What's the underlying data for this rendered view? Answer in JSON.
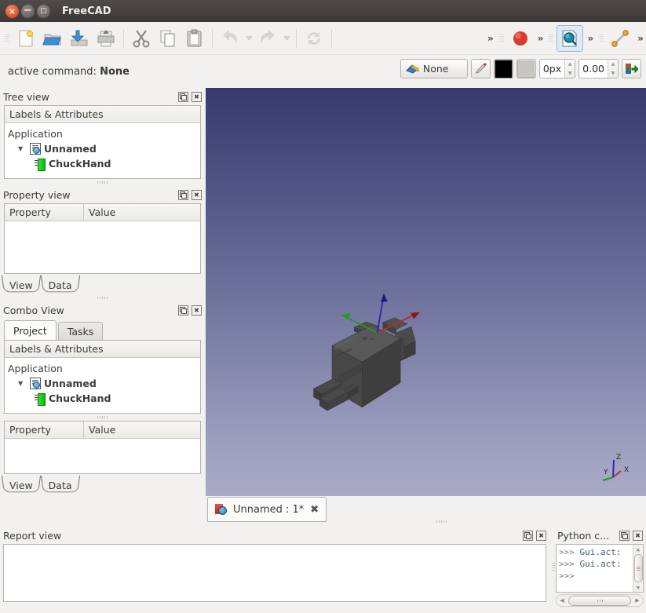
{
  "window": {
    "title": "FreeCAD",
    "buttons": {
      "close": "×",
      "minimize": "−",
      "maximize": "□"
    }
  },
  "toolbar_main": {
    "items": [
      {
        "name": "new-document-icon",
        "label": "New"
      },
      {
        "name": "open-document-icon",
        "label": "Open"
      },
      {
        "name": "save-document-icon",
        "label": "Save"
      },
      {
        "name": "print-icon",
        "label": "Print"
      },
      {
        "name": "cut-icon",
        "label": "Cut"
      },
      {
        "name": "copy-icon",
        "label": "Copy"
      },
      {
        "name": "paste-icon",
        "label": "Paste"
      },
      {
        "name": "undo-icon",
        "label": "Undo"
      },
      {
        "name": "redo-icon",
        "label": "Redo"
      },
      {
        "name": "refresh-icon",
        "label": "Refresh"
      }
    ],
    "overflow_glyph": "»",
    "right_items": [
      {
        "name": "sphere-icon",
        "label": "Sphere"
      },
      {
        "name": "zoom-document-icon",
        "label": "Zoom document"
      },
      {
        "name": "line-icon",
        "label": "Line"
      }
    ]
  },
  "toolbar_secondary": {
    "active_command_label": "active command:",
    "active_command_value": "None",
    "style_button_label": "None",
    "pen_button": "pen-icon",
    "color_swatch_primary": "#000000",
    "color_swatch_secondary": "#c9c6c2",
    "line_width_value": "0px",
    "opacity_value": "0.00",
    "apply_button": "apply-icon"
  },
  "tree_view": {
    "title": "Tree view",
    "column_header": "Labels & Attributes",
    "root": "Application",
    "document": "Unnamed",
    "child": "ChuckHand"
  },
  "property_view": {
    "title": "Property view",
    "columns": [
      "Property",
      "Value"
    ],
    "rows": [],
    "tabs": [
      "View",
      "Data"
    ],
    "selected_tab": "View"
  },
  "combo_view": {
    "title": "Combo View",
    "tabs": [
      "Project",
      "Tasks"
    ],
    "selected_tab": "Project",
    "column_header": "Labels & Attributes",
    "root": "Application",
    "document": "Unnamed",
    "child": "ChuckHand",
    "property_columns": [
      "Property",
      "Value"
    ],
    "property_tabs": [
      "View",
      "Data"
    ],
    "selected_property_tab": "View"
  },
  "view3d": {
    "document_tab_label": "Unnamed : 1*",
    "document_tab_close": "✖",
    "axis_labels": {
      "x": "X",
      "y": "Y",
      "z": "Z"
    },
    "axis_colors": {
      "x": "#b03030",
      "y": "#1f9a1f",
      "z": "#2a2ab0"
    },
    "background_top": "#373a6d",
    "background_bottom": "#a8aac7",
    "model_color": "#4a4a4a",
    "model_name": "ChuckHand"
  },
  "report_view": {
    "title": "Report view",
    "content": ""
  },
  "python_console": {
    "title": "Python c...",
    "lines": [
      {
        "prompt": ">>>",
        "text": "Gui.act:"
      },
      {
        "prompt": ">>>",
        "text": "Gui.act:"
      },
      {
        "prompt": ">>>",
        "text": ""
      }
    ]
  },
  "dock_controls": {
    "float": "❐",
    "close": "✖"
  }
}
